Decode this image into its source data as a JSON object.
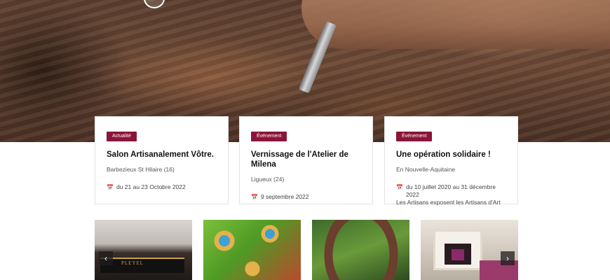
{
  "cards": [
    {
      "badge": "Actualité",
      "title": "Salon Artisanalement Vôtre.",
      "place": "Barbezieux St Hilaire (16)",
      "date": "du 21 au 23 Octobre 2022",
      "note": ""
    },
    {
      "badge": "Événement",
      "title": "Vernissage de l'Atelier de Milena",
      "place": "Ligueux (24)",
      "date": "9 septembre 2022",
      "note": ""
    },
    {
      "badge": "Événement",
      "title": "Une opération solidaire !",
      "place": "En Nouvelle-Aquitaine",
      "date": "du 10 juillet 2020 au 31 décembre 2022",
      "note": "Les Artisans exposent les Artisans d'Art"
    }
  ],
  "gallery": {
    "items": [
      {
        "name": "piano-workshop-photo",
        "label": "PLEYEL"
      },
      {
        "name": "peacock-enamel-photo"
      },
      {
        "name": "leather-horseshoe-photo"
      },
      {
        "name": "fireplace-room-photo"
      }
    ],
    "prev_icon": "chevron-left-icon",
    "next_icon": "chevron-right-icon"
  },
  "colors": {
    "accent": "#8b1538"
  }
}
